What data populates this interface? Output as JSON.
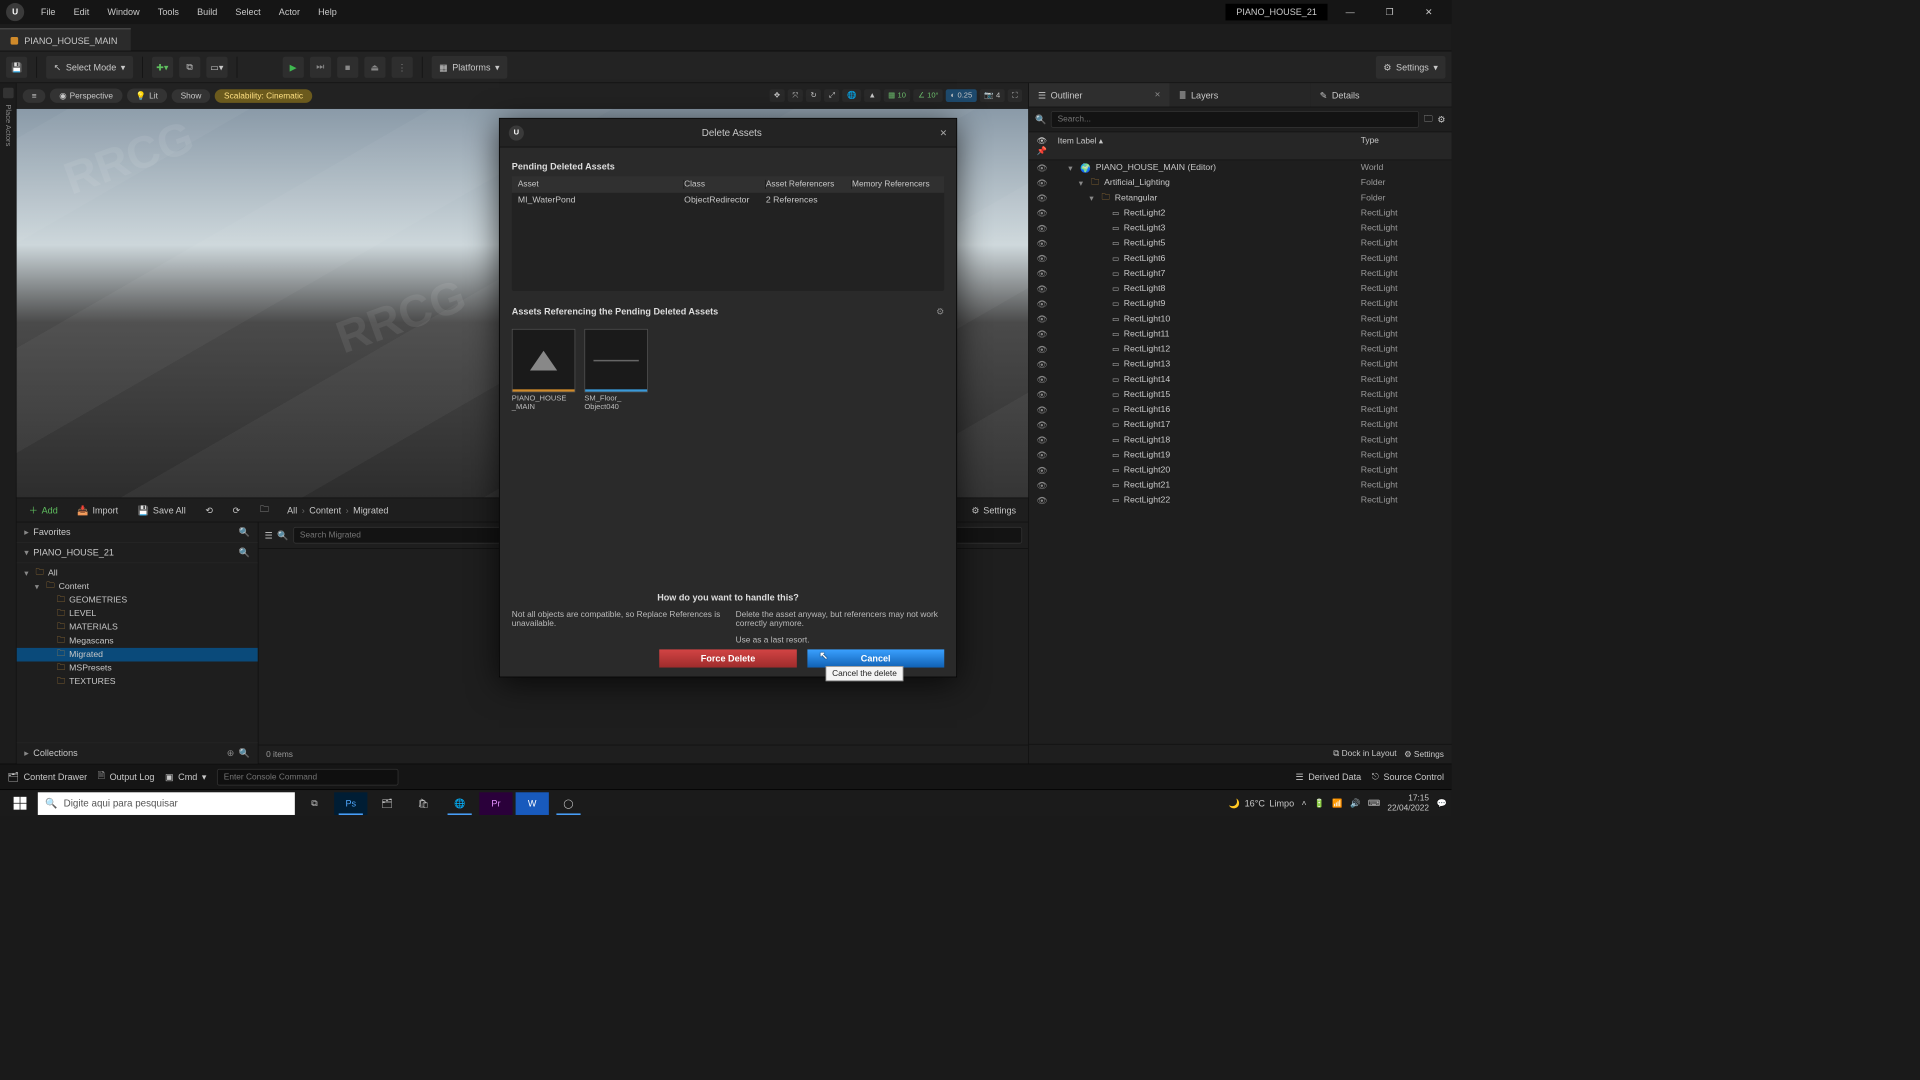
{
  "project_chip": "PIANO_HOUSE_21",
  "menus": [
    "File",
    "Edit",
    "Window",
    "Tools",
    "Build",
    "Select",
    "Actor",
    "Help"
  ],
  "tab_name": "PIANO_HOUSE_MAIN",
  "toolbar": {
    "select_mode": "Select Mode",
    "platforms": "Platforms",
    "settings": "Settings"
  },
  "viewport_pills": {
    "perspective": "Perspective",
    "lit": "Lit",
    "show": "Show",
    "scalability": "Scalability: Cinematic"
  },
  "viewport_right": {
    "grid": "10",
    "angle": "10°",
    "scale": "0.25",
    "cam": "4"
  },
  "right_panel": {
    "tabs": [
      "Outliner",
      "Layers",
      "Details"
    ],
    "search_ph": "Search...",
    "header": {
      "item": "Item Label",
      "type": "Type"
    },
    "rows": [
      {
        "indent": 1,
        "arrow": "▾",
        "icon": "world",
        "label": "PIANO_HOUSE_MAIN (Editor)",
        "type": "World"
      },
      {
        "indent": 2,
        "arrow": "▾",
        "icon": "folder",
        "label": "Artificial_Lighting",
        "type": "Folder"
      },
      {
        "indent": 3,
        "arrow": "▾",
        "icon": "folder",
        "label": "Retangular",
        "type": "Folder"
      },
      {
        "indent": 4,
        "icon": "light",
        "label": "RectLight2",
        "type": "RectLight"
      },
      {
        "indent": 4,
        "icon": "light",
        "label": "RectLight3",
        "type": "RectLight"
      },
      {
        "indent": 4,
        "icon": "light",
        "label": "RectLight5",
        "type": "RectLight"
      },
      {
        "indent": 4,
        "icon": "light",
        "label": "RectLight6",
        "type": "RectLight"
      },
      {
        "indent": 4,
        "icon": "light",
        "label": "RectLight7",
        "type": "RectLight"
      },
      {
        "indent": 4,
        "icon": "light",
        "label": "RectLight8",
        "type": "RectLight"
      },
      {
        "indent": 4,
        "icon": "light",
        "label": "RectLight9",
        "type": "RectLight"
      },
      {
        "indent": 4,
        "icon": "light",
        "label": "RectLight10",
        "type": "RectLight"
      },
      {
        "indent": 4,
        "icon": "light",
        "label": "RectLight11",
        "type": "RectLight"
      },
      {
        "indent": 4,
        "icon": "light",
        "label": "RectLight12",
        "type": "RectLight"
      },
      {
        "indent": 4,
        "icon": "light",
        "label": "RectLight13",
        "type": "RectLight"
      },
      {
        "indent": 4,
        "icon": "light",
        "label": "RectLight14",
        "type": "RectLight"
      },
      {
        "indent": 4,
        "icon": "light",
        "label": "RectLight15",
        "type": "RectLight"
      },
      {
        "indent": 4,
        "icon": "light",
        "label": "RectLight16",
        "type": "RectLight"
      },
      {
        "indent": 4,
        "icon": "light",
        "label": "RectLight17",
        "type": "RectLight"
      },
      {
        "indent": 4,
        "icon": "light",
        "label": "RectLight18",
        "type": "RectLight"
      },
      {
        "indent": 4,
        "icon": "light",
        "label": "RectLight19",
        "type": "RectLight"
      },
      {
        "indent": 4,
        "icon": "light",
        "label": "RectLight20",
        "type": "RectLight"
      },
      {
        "indent": 4,
        "icon": "light",
        "label": "RectLight21",
        "type": "RectLight"
      },
      {
        "indent": 4,
        "icon": "light",
        "label": "RectLight22",
        "type": "RectLight"
      }
    ],
    "dock": "Dock in Layout",
    "settings": "Settings"
  },
  "cb": {
    "add": "Add",
    "import": "Import",
    "save_all": "Save All",
    "crumbs": [
      "All",
      "Content",
      "Migrated"
    ],
    "favorites": "Favorites",
    "project": "PIANO_HOUSE_21",
    "tree": [
      {
        "indent": 0,
        "arrow": "▾",
        "label": "All"
      },
      {
        "indent": 1,
        "arrow": "▾",
        "label": "Content"
      },
      {
        "indent": 2,
        "label": "GEOMETRIES"
      },
      {
        "indent": 2,
        "label": "LEVEL"
      },
      {
        "indent": 2,
        "label": "MATERIALS"
      },
      {
        "indent": 2,
        "label": "Megascans"
      },
      {
        "indent": 2,
        "label": "Migrated",
        "sel": true
      },
      {
        "indent": 2,
        "label": "MSPresets"
      },
      {
        "indent": 2,
        "label": "TEXTURES"
      }
    ],
    "collections": "Collections",
    "search_ph": "Search Migrated",
    "items": "0 items"
  },
  "bottombar": {
    "drawer": "Content Drawer",
    "log": "Output Log",
    "cmd": "Cmd",
    "console_ph": "Enter Console Command",
    "derived": "Derived Data",
    "source": "Source Control"
  },
  "taskbar": {
    "search_ph": "Digite aqui para pesquisar",
    "weather_temp": "16°C",
    "weather_desc": "Limpo",
    "time": "17:15",
    "date": "22/04/2022"
  },
  "modal": {
    "title": "Delete Assets",
    "pending_title": "Pending Deleted Assets",
    "th": {
      "asset": "Asset",
      "class": "Class",
      "refs": "Asset Referencers",
      "mem": "Memory Referencers"
    },
    "row": {
      "asset": "MI_WaterPond",
      "class": "ObjectRedirector",
      "refs": "2 References"
    },
    "ref_title": "Assets Referencing the Pending Deleted Assets",
    "thumbs": [
      {
        "cap1": "PIANO_HOUSE",
        "cap2": "_MAIN",
        "bar": "#d08a2a"
      },
      {
        "cap1": "SM_Floor_",
        "cap2": "Object040",
        "bar": "#3a9ad9"
      }
    ],
    "prompt": "How do you want to handle this?",
    "left_note": "Not all objects are compatible, so Replace References is unavailable.",
    "right_note": "Delete the asset anyway, but referencers may not work correctly anymore.",
    "last_resort": "Use as a last resort.",
    "force": "Force Delete",
    "cancel": "Cancel",
    "tooltip": "Cancel the delete"
  },
  "rail_label": "Place Actors"
}
